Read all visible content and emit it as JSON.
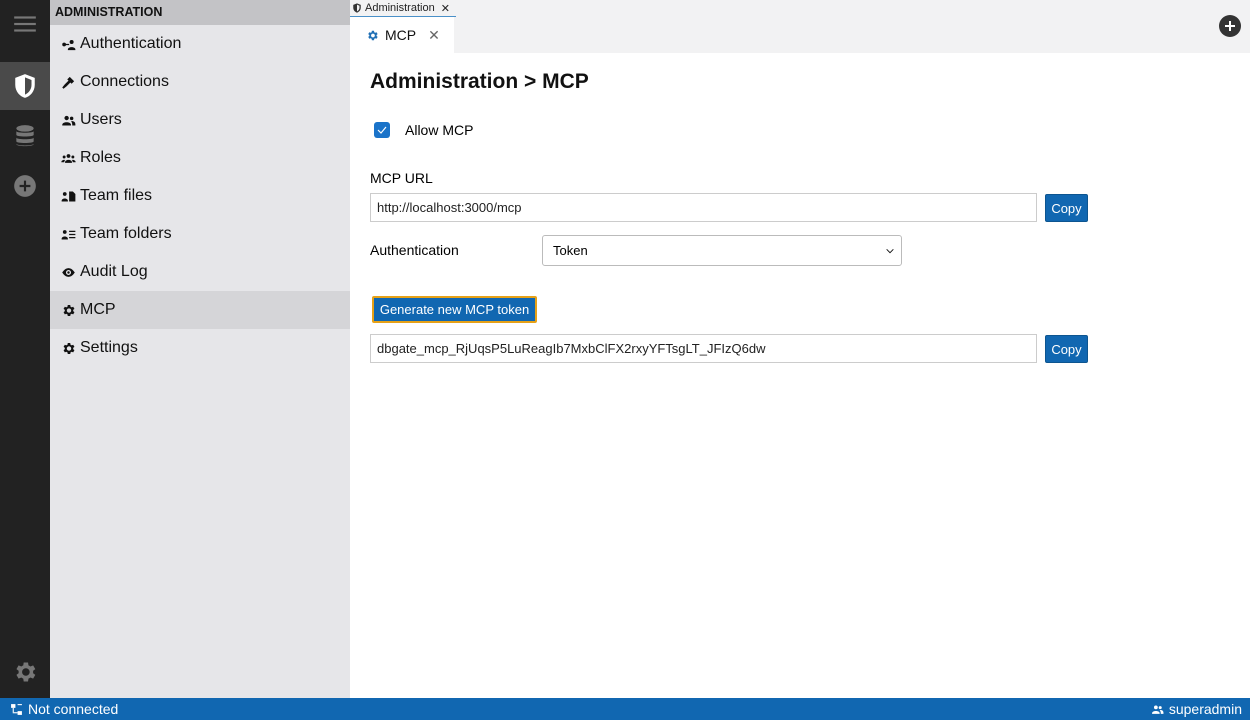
{
  "iconbar": {
    "items": [
      {
        "icon": "menu-icon"
      },
      {
        "icon": "shield-icon",
        "active": true
      },
      {
        "icon": "database-icon"
      },
      {
        "icon": "plus-circle-icon"
      }
    ],
    "bottom_icon": "settings-icon"
  },
  "sidebar": {
    "header": "ADMINISTRATION",
    "items": [
      {
        "label": "Authentication",
        "icon": "key-user-icon"
      },
      {
        "label": "Connections",
        "icon": "plug-icon"
      },
      {
        "label": "Users",
        "icon": "users-icon"
      },
      {
        "label": "Roles",
        "icon": "roles-icon"
      },
      {
        "label": "Team files",
        "icon": "team-files-icon"
      },
      {
        "label": "Team folders",
        "icon": "team-folders-icon"
      },
      {
        "label": "Audit Log",
        "icon": "eye-icon"
      },
      {
        "label": "MCP",
        "icon": "gear-icon",
        "active": true
      },
      {
        "label": "Settings",
        "icon": "gear-icon"
      }
    ]
  },
  "tabs": {
    "group_label": "Administration",
    "active_tab": "MCP"
  },
  "main": {
    "title": "Administration > MCP",
    "allow_label": "Allow MCP",
    "allow_checked": true,
    "url_label": "MCP URL",
    "url_value": "http://localhost:3000/mcp",
    "copy_label": "Copy",
    "auth_label": "Authentication",
    "auth_value": "Token",
    "generate_label": "Generate new MCP token",
    "token_value": "dbgate_mcp_RjUqsP5LuReagIb7MxbClFX2rxyYFTsgLT_JFIzQ6dw"
  },
  "status": {
    "connection": "Not connected",
    "user": "superadmin"
  },
  "colors": {
    "accent": "#1167b1",
    "iconbar_bg": "#222222",
    "sidebar_bg": "#e6e6e9",
    "focus_border": "#e6a117"
  }
}
